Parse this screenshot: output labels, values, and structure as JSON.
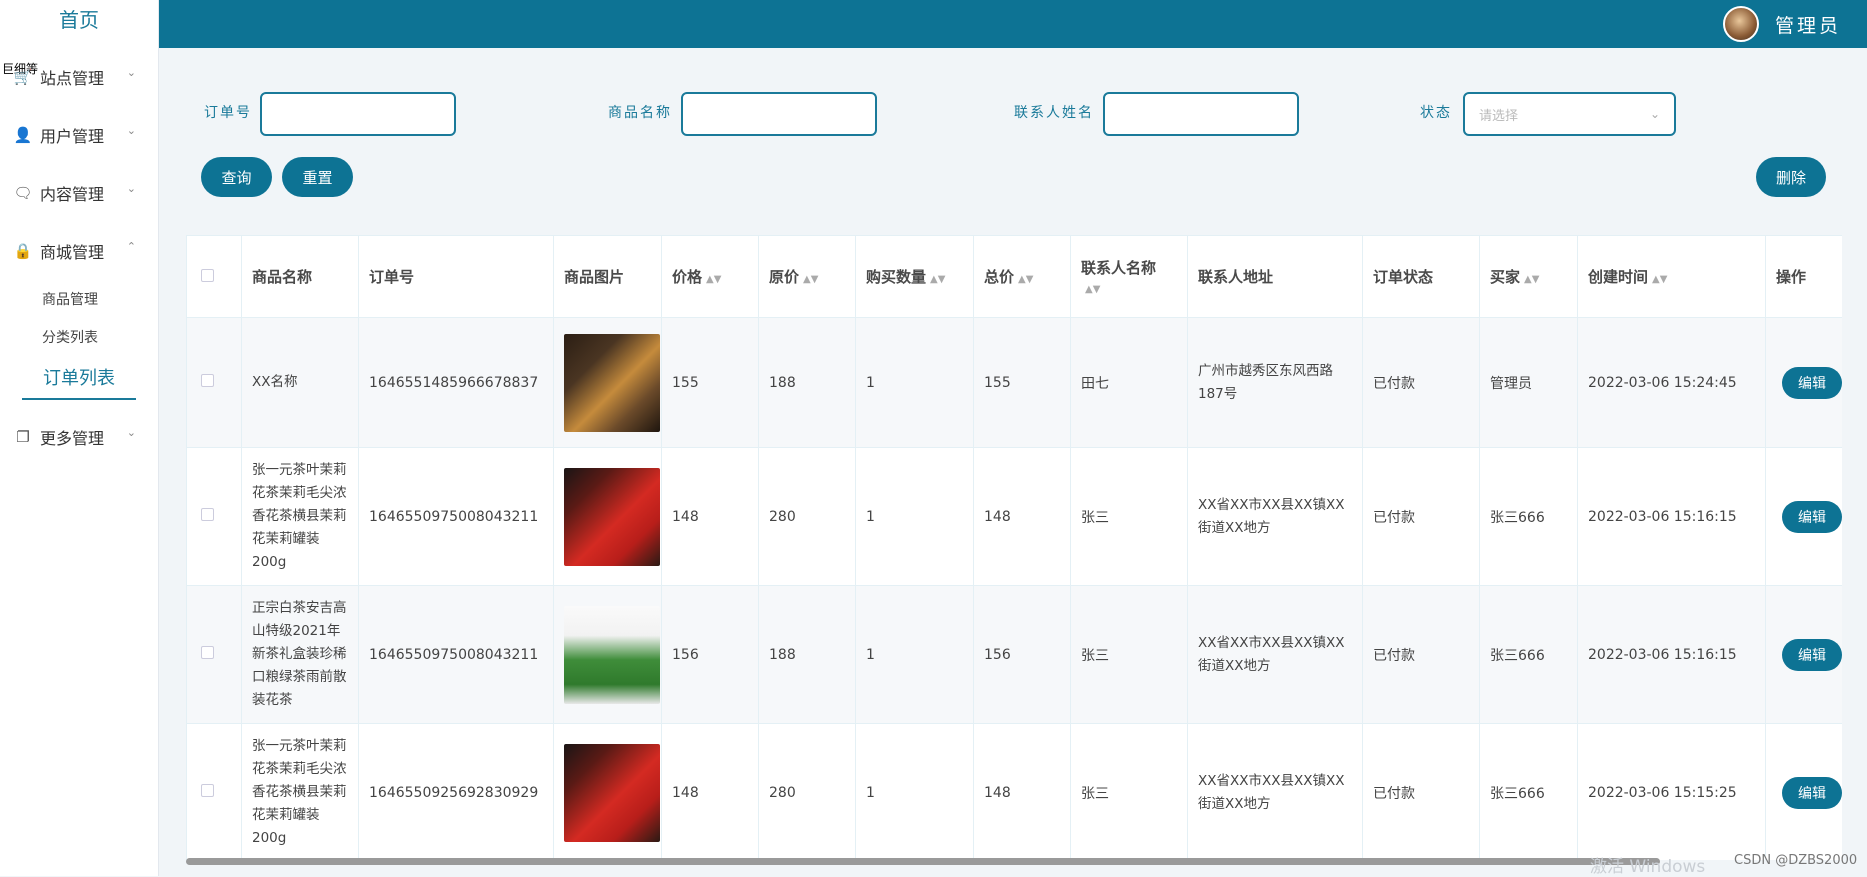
{
  "sidebar": {
    "home": "首页",
    "overlay_text": "巨细等",
    "menu": [
      {
        "label": "站点管理",
        "icon": "cart-icon"
      },
      {
        "label": "用户管理",
        "icon": "user-icon"
      },
      {
        "label": "内容管理",
        "icon": "chat-icon"
      },
      {
        "label": "商城管理",
        "icon": "lock-icon"
      },
      {
        "label": "更多管理",
        "icon": "copy-icon"
      }
    ],
    "sub": [
      "商品管理",
      "分类列表",
      "订单列表"
    ]
  },
  "topbar": {
    "user_name": "管理员"
  },
  "filters": {
    "order_no_label": "订单号",
    "goods_name_label": "商品名称",
    "contact_name_label": "联系人姓名",
    "status_label": "状态",
    "status_placeholder": "请选择"
  },
  "buttons": {
    "query": "查询",
    "reset": "重置",
    "delete": "删除",
    "edit": "编辑"
  },
  "table": {
    "headers": [
      "商品名称",
      "订单号",
      "商品图片",
      "价格",
      "原价",
      "购买数量",
      "总价",
      "联系人名称",
      "联系人地址",
      "订单状态",
      "买家",
      "创建时间",
      "操作"
    ],
    "rows": [
      {
        "name": "XX名称",
        "order_no": "1646551485966678837",
        "price": "155",
        "orig": "188",
        "qty": "1",
        "total": "155",
        "contact": "田七",
        "address": "广州市越秀区东风西路187号",
        "status": "已付款",
        "buyer": "管理员",
        "time": "2022-03-06 15:24:45"
      },
      {
        "name": "张一元茶叶茉莉花茶茉莉毛尖浓香花茶横县茉莉花茉莉罐装200g",
        "order_no": "1646550975008043211",
        "price": "148",
        "orig": "280",
        "qty": "1",
        "total": "148",
        "contact": "张三",
        "address": "XX省XX市XX县XX镇XX街道XX地方",
        "status": "已付款",
        "buyer": "张三666",
        "time": "2022-03-06 15:16:15"
      },
      {
        "name": "正宗白茶安吉高山特级2021年新茶礼盒装珍稀口粮绿茶雨前散装花茶",
        "order_no": "1646550975008043211",
        "price": "156",
        "orig": "188",
        "qty": "1",
        "total": "156",
        "contact": "张三",
        "address": "XX省XX市XX县XX镇XX街道XX地方",
        "status": "已付款",
        "buyer": "张三666",
        "time": "2022-03-06 15:16:15"
      },
      {
        "name": "张一元茶叶茉莉花茶茉莉毛尖浓香花茶横县茉莉花茉莉罐装200g",
        "order_no": "1646550925692830929",
        "price": "148",
        "orig": "280",
        "qty": "1",
        "total": "148",
        "contact": "张三",
        "address": "XX省XX市XX县XX镇XX街道XX地方",
        "status": "已付款",
        "buyer": "张三666",
        "time": "2022-03-06 15:15:25"
      }
    ]
  },
  "footer": {
    "watermark": "激活 Windows",
    "credit": "CSDN @DZBS2000"
  },
  "colors": {
    "primary": "#0d7394",
    "accent_text": "#1a7a9a"
  }
}
